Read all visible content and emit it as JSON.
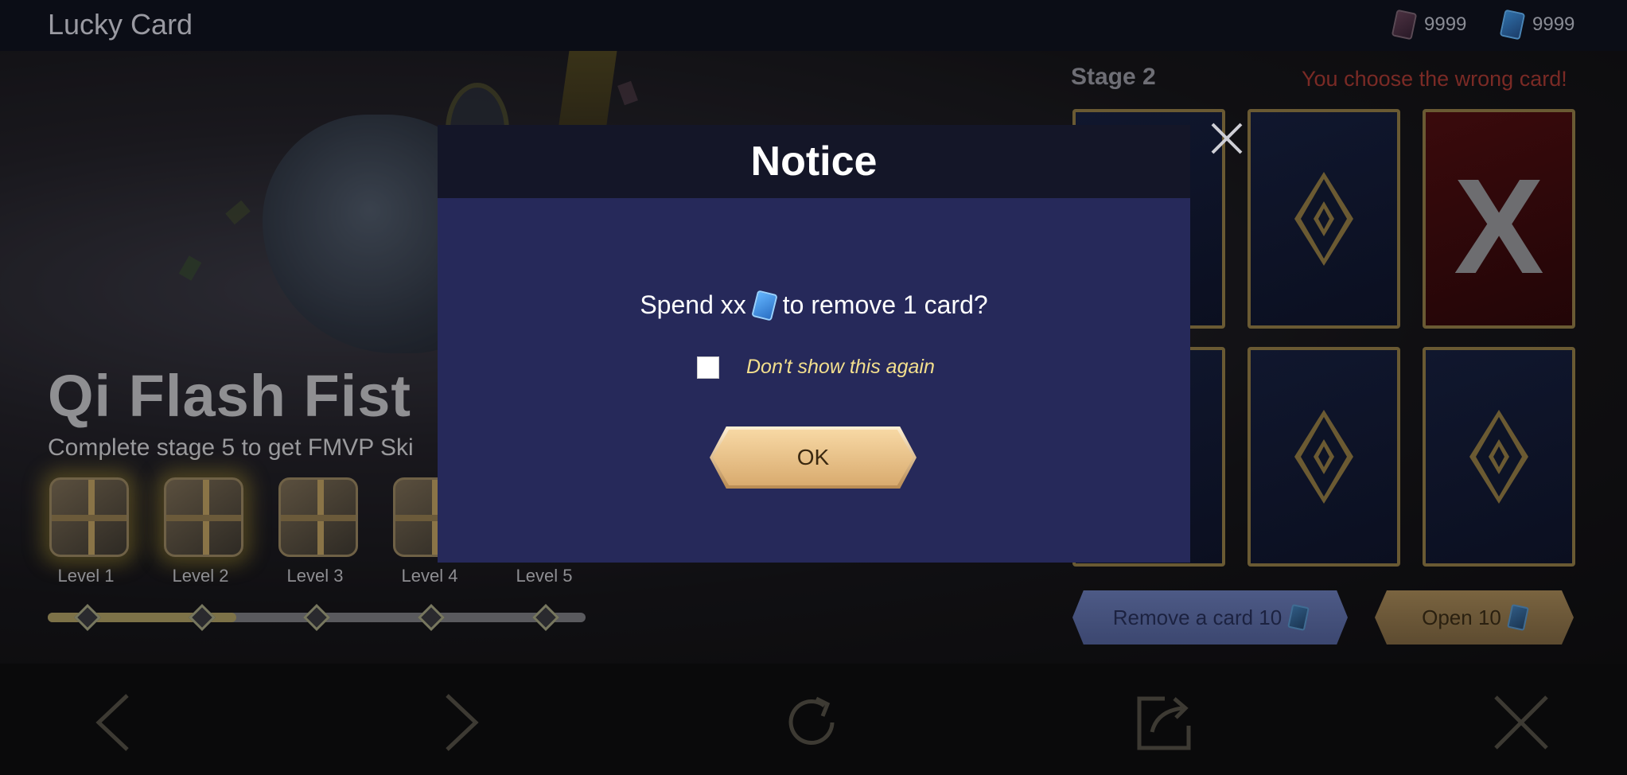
{
  "header": {
    "title": "Lucky Card",
    "currencies": [
      {
        "icon": "red-card-ticket-icon",
        "amount": "9999"
      },
      {
        "icon": "blue-card-ticket-icon",
        "amount": "9999"
      }
    ]
  },
  "hero": {
    "title": "Qi Flash Fist",
    "subtitle": "Complete stage 5 to get FMVP Ski",
    "levels": [
      "Level 1",
      "Level 2",
      "Level 3",
      "Level 4",
      "Level 5"
    ],
    "progress_fraction": 0.35
  },
  "stage": {
    "title": "Stage 2",
    "message": "You choose the wrong card!",
    "cards": [
      {
        "state": "hidden"
      },
      {
        "state": "hidden"
      },
      {
        "state": "wrong",
        "mark": "X"
      },
      {
        "state": "hidden"
      },
      {
        "state": "hidden"
      },
      {
        "state": "hidden"
      }
    ],
    "remove_button": "Remove a card 10",
    "open_button": "Open 10"
  },
  "bottom_nav": [
    "chevron-left-icon",
    "chevron-right-icon",
    "refresh-icon",
    "share-icon",
    "close-icon"
  ],
  "modal": {
    "title": "Notice",
    "question_before": "Spend xx",
    "question_after": "to remove 1 card?",
    "checkbox_label": "Don't show this again",
    "ok_label": "OK"
  },
  "colors": {
    "modal_bg": "#26295a",
    "modal_header": "#141628",
    "checkbox_label": "#f3df8d",
    "ok_button": "#f7d8a4",
    "wrong_text": "#7a2a25"
  }
}
